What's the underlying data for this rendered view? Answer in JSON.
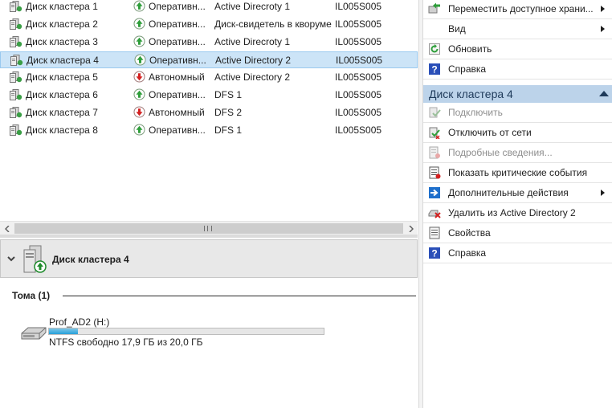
{
  "disks": [
    {
      "name": "Диск кластера 1",
      "status": "Оперативн...",
      "online": true,
      "group": "Active Direcroty 1",
      "node": "IL005S005",
      "selected": false
    },
    {
      "name": "Диск кластера 2",
      "status": "Оперативн...",
      "online": true,
      "group": "Диск-свидетель в кворуме",
      "node": "IL005S005",
      "selected": false
    },
    {
      "name": "Диск кластера 3",
      "status": "Оперативн...",
      "online": true,
      "group": "Active Direcroty 1",
      "node": "IL005S005",
      "selected": false
    },
    {
      "name": "Диск кластера 4",
      "status": "Оперативн...",
      "online": true,
      "group": "Active Directory 2",
      "node": "IL005S005",
      "selected": true
    },
    {
      "name": "Диск кластера 5",
      "status": "Автономный",
      "online": false,
      "group": "Active Directory 2",
      "node": "IL005S005",
      "selected": false
    },
    {
      "name": "Диск кластера 6",
      "status": "Оперативн...",
      "online": true,
      "group": "DFS 1",
      "node": "IL005S005",
      "selected": false
    },
    {
      "name": "Диск кластера 7",
      "status": "Автономный",
      "online": false,
      "group": "DFS 2",
      "node": "IL005S005",
      "selected": false
    },
    {
      "name": "Диск кластера 8",
      "status": "Оперативн...",
      "online": true,
      "group": "DFS 1",
      "node": "IL005S005",
      "selected": false
    }
  ],
  "details": {
    "title": "Диск кластера 4",
    "volumes_header": "Тома (1)",
    "volume": {
      "name": "Prof_AD2 (H:)",
      "info": "NTFS свободно 17,9 ГБ из 20,0 ГБ",
      "used_fraction": 0.105
    }
  },
  "actions_top": [
    {
      "label": "Переместить доступное храни...",
      "icon": "move-storage-icon",
      "submenu": true,
      "disabled": false
    },
    {
      "label": "Вид",
      "icon": "",
      "submenu": true,
      "disabled": false
    },
    {
      "label": "Обновить",
      "icon": "refresh-icon",
      "submenu": false,
      "disabled": false
    },
    {
      "label": "Справка",
      "icon": "help-icon",
      "submenu": false,
      "disabled": false
    }
  ],
  "section": {
    "title": "Диск кластера 4"
  },
  "actions_disk": [
    {
      "label": "Подключить",
      "icon": "bring-online-icon",
      "submenu": false,
      "disabled": true
    },
    {
      "label": "Отключить от сети",
      "icon": "take-offline-icon",
      "submenu": false,
      "disabled": false
    },
    {
      "label": "Подробные сведения...",
      "icon": "details-icon",
      "submenu": false,
      "disabled": true
    },
    {
      "label": "Показать критические события",
      "icon": "critical-events-icon",
      "submenu": false,
      "disabled": false
    },
    {
      "label": "Дополнительные действия",
      "icon": "more-actions-icon",
      "submenu": true,
      "disabled": false
    },
    {
      "label": "Удалить из Active Directory 2",
      "icon": "remove-icon",
      "submenu": false,
      "disabled": false
    },
    {
      "label": "Свойства",
      "icon": "properties-icon",
      "submenu": false,
      "disabled": false
    },
    {
      "label": "Справка",
      "icon": "help-icon",
      "submenu": false,
      "disabled": false
    }
  ],
  "colors": {
    "selection": "#cce4f7",
    "section_header": "#bcd3ea",
    "online_green": "#2e9e3a",
    "offline_red": "#d42020"
  }
}
